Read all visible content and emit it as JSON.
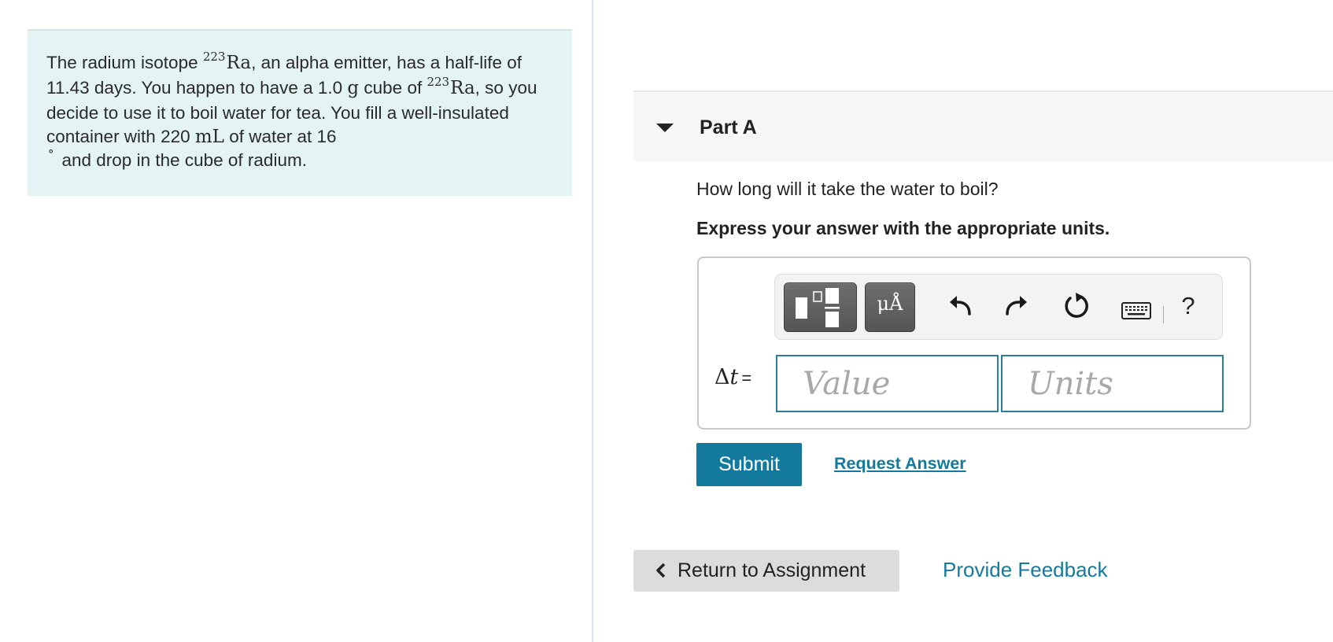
{
  "problem": {
    "t1": "The radium isotope ",
    "iso1_mass": "223",
    "iso1_symbol": "Ra",
    "t2": ", an alpha emitter, has a half-life of 11.43 days. You happen to have a 1.0 ",
    "mass_unit": "g",
    "t3": " cube of ",
    "iso2_mass": "223",
    "iso2_symbol": "Ra",
    "t4": ", so you decide to use it to boil water for tea. You fill a well-insulated container with 220 ",
    "volume_unit": "mL",
    "t5": " of water at 16 ",
    "degree": "°",
    "t6": "and drop in the cube of radium."
  },
  "part": {
    "title": "Part A",
    "question": "How long will it take the water to boil?",
    "instruction": "Express your answer with the appropriate units."
  },
  "toolbar": {
    "symbols_label": "μÅ",
    "help_label": "?",
    "icons": [
      "templates-icon",
      "symbols-icon",
      "undo-icon",
      "redo-icon",
      "reset-icon",
      "keyboard-icon",
      "help-icon"
    ]
  },
  "answer": {
    "variable_symbol": "Δ",
    "variable_name": "t",
    "equals": "=",
    "value_placeholder": "Value",
    "units_placeholder": "Units"
  },
  "actions": {
    "submit_label": "Submit",
    "request_answer_label": "Request Answer",
    "return_label": "Return to Assignment",
    "feedback_label": "Provide Feedback"
  },
  "colors": {
    "accent": "#137a9e",
    "problem_bg": "#e4f4f4",
    "input_border": "#2a7d9c"
  }
}
